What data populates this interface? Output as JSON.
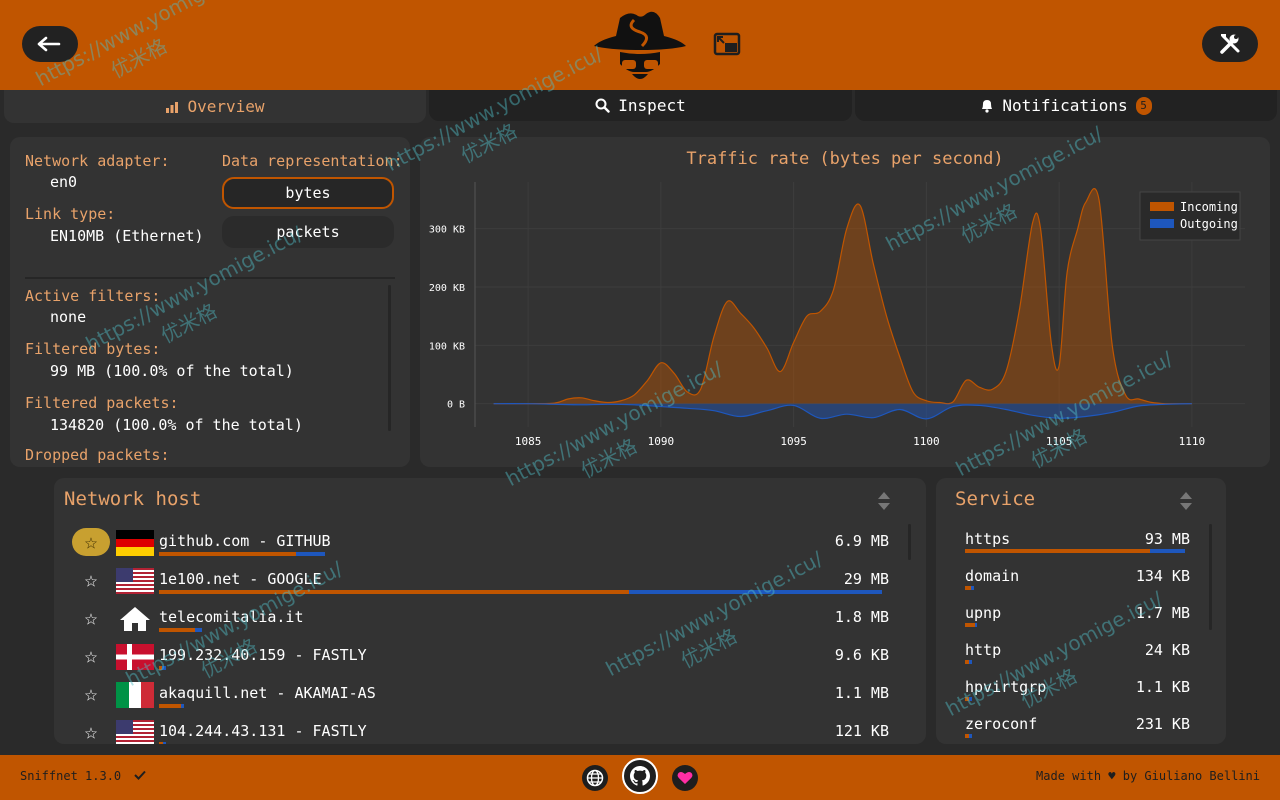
{
  "tabs": {
    "overview": "Overview",
    "inspect": "Inspect",
    "notifications": "Notifications",
    "notifications_count": "5"
  },
  "info": {
    "adapter_label": "Network adapter:",
    "adapter_value": "en0",
    "link_label": "Link type:",
    "link_value": "EN10MB (Ethernet)",
    "repr_label": "Data representation:",
    "repr_bytes": "bytes",
    "repr_packets": "packets",
    "repr_selected": "bytes",
    "filters_label": "Active filters:",
    "filters_value": "none",
    "fbytes_label": "Filtered bytes:",
    "fbytes_value": "99 MB (100.0% of the total)",
    "fpackets_label": "Filtered packets:",
    "fpackets_value": "134820 (100.0% of the total)",
    "dropped_label": "Dropped packets:"
  },
  "chart_data": {
    "type": "area",
    "title": "Traffic rate (bytes per second)",
    "x_ticks": [
      1085,
      1090,
      1095,
      1100,
      1105,
      1110
    ],
    "y_ticks": [
      "0 B",
      "100 KB",
      "200 KB",
      "300 KB"
    ],
    "xlim": [
      1083,
      1112
    ],
    "ylim": [
      -40,
      380
    ],
    "legend_position": "top-right",
    "series": [
      {
        "name": "Incoming",
        "color": "#c05500",
        "x": [
          1083.7,
          1084,
          1084.5,
          1085,
          1086,
          1086.5,
          1087,
          1087.5,
          1088,
          1088.5,
          1089,
          1089.5,
          1090,
          1090.5,
          1091,
          1091.5,
          1092,
          1092.5,
          1093,
          1093.5,
          1094,
          1094.5,
          1095,
          1095.5,
          1096,
          1096.5,
          1097,
          1097.5,
          1098,
          1098.5,
          1099,
          1099.5,
          1100,
          1100.5,
          1101,
          1101.5,
          1102,
          1102.5,
          1103,
          1103.5,
          1104,
          1104.3,
          1104.7,
          1105,
          1105.3,
          1105.7,
          1106,
          1106.5,
          1107,
          1107.5,
          1108,
          1108.5,
          1109,
          1109.5,
          1110
        ],
        "values": [
          0,
          0,
          0,
          0,
          1,
          8,
          10,
          5,
          2,
          5,
          15,
          40,
          70,
          52,
          20,
          25,
          115,
          175,
          155,
          130,
          95,
          55,
          105,
          150,
          158,
          195,
          300,
          340,
          240,
          150,
          80,
          20,
          5,
          2,
          3,
          40,
          28,
          25,
          55,
          160,
          310,
          300,
          105,
          65,
          225,
          300,
          345,
          350,
          100,
          15,
          8,
          2,
          0,
          0,
          0
        ]
      },
      {
        "name": "Outgoing",
        "color": "#1e57bd",
        "x": [
          1083.7,
          1085,
          1086,
          1087,
          1088,
          1089,
          1090,
          1091,
          1092,
          1093,
          1094,
          1095,
          1096,
          1097,
          1098,
          1099,
          1100,
          1101,
          1102,
          1103,
          1104,
          1105,
          1106,
          1107,
          1108,
          1109,
          1110
        ],
        "values": [
          0,
          0,
          -1,
          -2,
          -1,
          -2,
          -5,
          -8,
          -12,
          -22,
          -12,
          -3,
          -25,
          -18,
          -24,
          -10,
          -26,
          -5,
          -3,
          -10,
          -20,
          -25,
          -22,
          -15,
          -4,
          -1,
          0
        ]
      }
    ]
  },
  "hosts": {
    "title": "Network host",
    "rows": [
      {
        "name": "github.com - GITHUB",
        "size": "6.9 MB",
        "flag": "de",
        "fav": true,
        "in": 0.19,
        "out": 0.04
      },
      {
        "name": "1e100.net - GOOGLE",
        "size": "29 MB",
        "flag": "us",
        "fav": false,
        "in": 0.65,
        "out": 0.35
      },
      {
        "name": "telecomitalia.it",
        "size": "1.8 MB",
        "flag": "home",
        "fav": false,
        "in": 0.05,
        "out": 0.01
      },
      {
        "name": "199.232.40.159 - FASTLY",
        "size": "9.6 KB",
        "flag": "dk",
        "fav": false,
        "in": 0.004,
        "out": 0.005
      },
      {
        "name": "akaquill.net - AKAMAI-AS",
        "size": "1.1 MB",
        "flag": "it",
        "fav": false,
        "in": 0.03,
        "out": 0.004
      },
      {
        "name": "104.244.43.131 - FASTLY",
        "size": "121 KB",
        "flag": "us",
        "fav": false,
        "in": 0.006,
        "out": 0.004
      }
    ]
  },
  "services": {
    "title": "Service",
    "rows": [
      {
        "name": "https",
        "size": "93 MB",
        "in": 0.84,
        "out": 0.16
      },
      {
        "name": "domain",
        "size": "134 KB",
        "in": 0.025,
        "out": 0.015
      },
      {
        "name": "upnp",
        "size": "1.7 MB",
        "in": 0.045,
        "out": 0.005
      },
      {
        "name": "http",
        "size": "24 KB",
        "in": 0.02,
        "out": 0.012
      },
      {
        "name": "hpvirtgrp",
        "size": "1.1 KB",
        "in": 0.02,
        "out": 0.012
      },
      {
        "name": "zeroconf",
        "size": "231 KB",
        "in": 0.02,
        "out": 0.012
      }
    ]
  },
  "footer": {
    "version": "Sniffnet 1.3.0",
    "credits": "Made with ♥ by Giuliano Bellini"
  },
  "watermark": {
    "url": "https://www.yomige.icu/",
    "cn": "优米格"
  },
  "colors": {
    "accent": "#c05500",
    "accent_text": "#e8a26a",
    "outgoing": "#1e57bd",
    "background": "#2a2a2a",
    "panel": "#333333"
  }
}
